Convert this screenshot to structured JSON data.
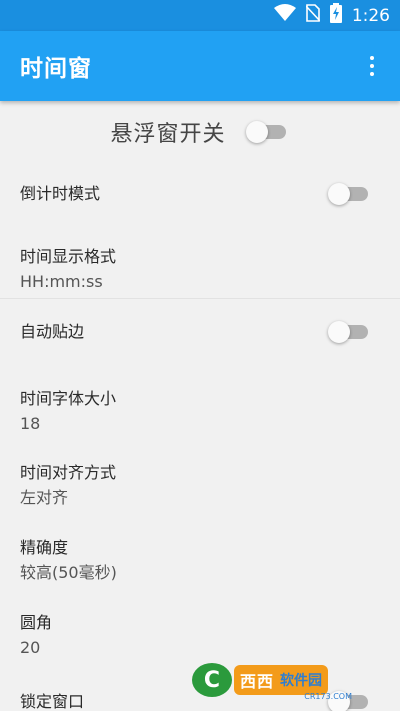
{
  "status_bar": {
    "time": "1:26",
    "icons": [
      "wifi-icon",
      "no-sim-icon",
      "battery-charging-icon"
    ]
  },
  "app_bar": {
    "title": "时间窗",
    "menu_icon": "overflow-menu-icon"
  },
  "floating_window_switch": {
    "label": "悬浮窗开关",
    "on": false
  },
  "preferences": [
    {
      "title": "倒计时模式",
      "type": "switch",
      "on": false
    },
    {
      "title": "时间显示格式",
      "summary": "HH:mm:ss"
    },
    {
      "title": "自动贴边",
      "type": "switch",
      "on": false
    },
    {
      "title": "时间字体大小",
      "summary": "18"
    },
    {
      "title": "时间对齐方式",
      "summary": "左对齐"
    },
    {
      "title": "精确度",
      "summary": "较高(50毫秒)"
    },
    {
      "title": "圆角",
      "summary": "20"
    },
    {
      "title": "锁定窗口",
      "type": "switch",
      "on": false
    }
  ],
  "watermark": {
    "logo_text": "C",
    "brand": "西西",
    "suffix": "软件园",
    "url": "CR173.COM"
  },
  "colors": {
    "status_bar": "#1a8fe0",
    "app_bar": "#21a1f3",
    "background": "#f1f1f1",
    "switch_off_track": "#b2b2b2"
  }
}
